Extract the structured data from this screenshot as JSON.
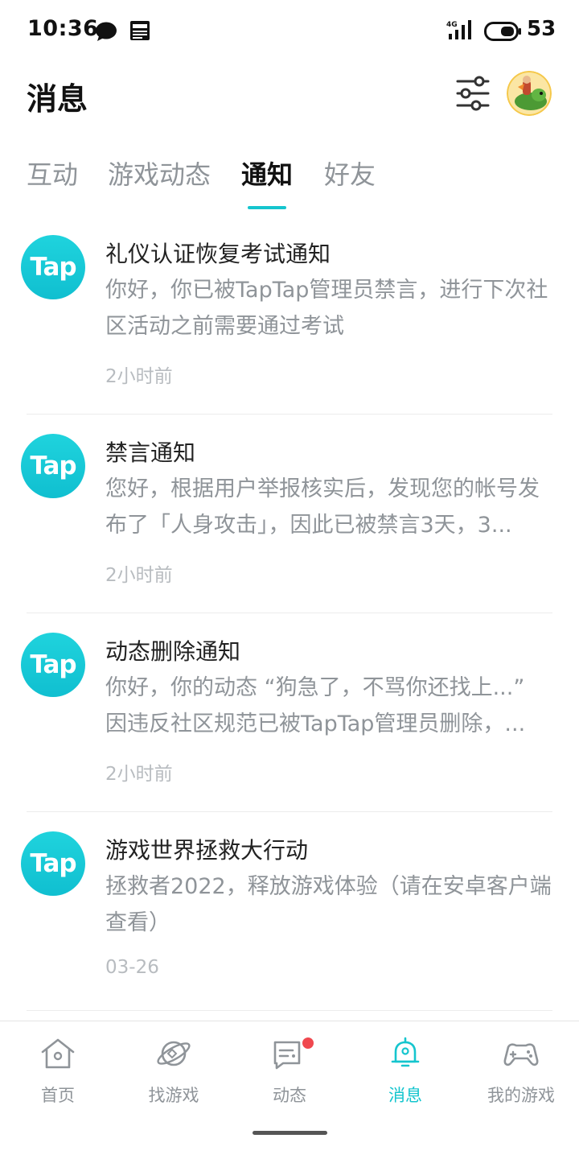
{
  "status_bar": {
    "time": "10:36",
    "battery": "53",
    "icons": [
      "chat-bubble-icon",
      "news-icon",
      "signal-4g-icon",
      "battery-icon"
    ]
  },
  "header": {
    "title": "消息",
    "filter_icon": "sliders-icon",
    "avatar_icon": "user-avatar"
  },
  "tabs": [
    {
      "label": "互动",
      "active": false
    },
    {
      "label": "游戏动态",
      "active": false
    },
    {
      "label": "通知",
      "active": true
    },
    {
      "label": "好友",
      "active": false
    }
  ],
  "notifications": [
    {
      "icon_text": "Tap",
      "title": "礼仪认证恢复考试通知",
      "body": "你好，你已被TapTap管理员禁言，进行下次社区活动之前需要通过考试",
      "time": "2小时前"
    },
    {
      "icon_text": "Tap",
      "title": "禁言通知",
      "body": "您好，根据用户举报核实后，发现您的帐号发布了「人身攻击」，因此已被禁言3天，3...",
      "time": "2小时前"
    },
    {
      "icon_text": "Tap",
      "title": "动态删除通知",
      "body": "你好，你的动态 “狗急了，不骂你还找上...” 因违反社区规范已被TapTap管理员删除，...",
      "time": "2小时前"
    },
    {
      "icon_text": "Tap",
      "title": "游戏世界拯救大行动",
      "body": "拯救者2022，释放游戏体验（请在安卓客户端查看）",
      "time": "03-26"
    }
  ],
  "bottom_nav": [
    {
      "label": "首页",
      "icon": "home-icon",
      "active": false,
      "badge": false
    },
    {
      "label": "找游戏",
      "icon": "planet-icon",
      "active": false,
      "badge": false
    },
    {
      "label": "动态",
      "icon": "chat-card-icon",
      "active": false,
      "badge": true
    },
    {
      "label": "消息",
      "icon": "bell-icon",
      "active": true,
      "badge": false
    },
    {
      "label": "我的游戏",
      "icon": "gamepad-icon",
      "active": false,
      "badge": false
    }
  ],
  "colors": {
    "accent": "#15c5ce",
    "badge": "#f0484f",
    "secondary_text": "#8f9499"
  }
}
